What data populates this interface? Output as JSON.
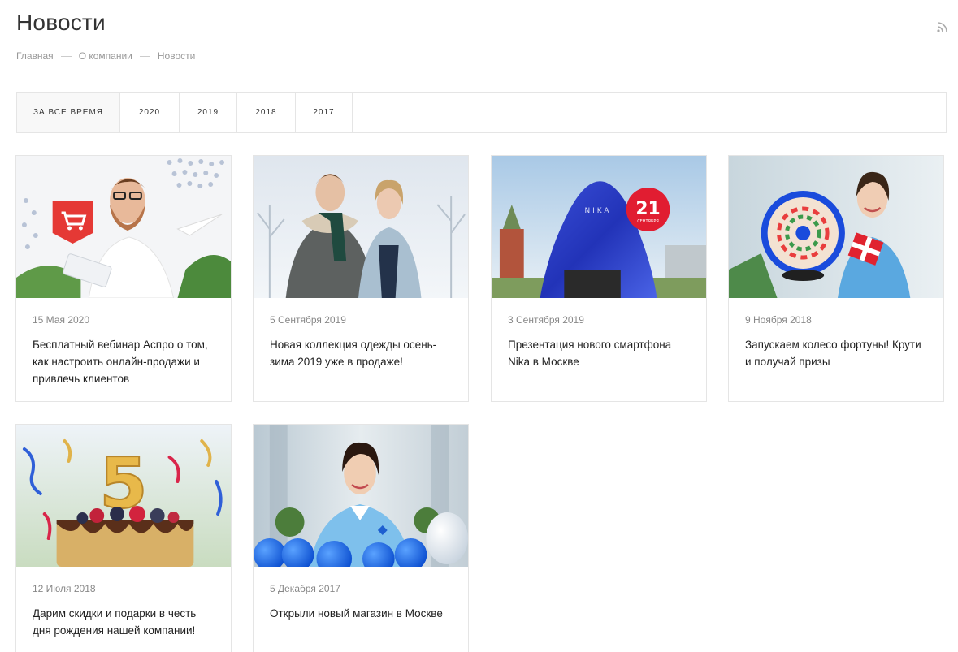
{
  "page": {
    "title": "Новости"
  },
  "breadcrumb": [
    "Главная",
    "О компании",
    "Новости"
  ],
  "filter": {
    "tabs": [
      "За все время",
      "2020",
      "2019",
      "2018",
      "2017"
    ],
    "active": 0
  },
  "news": [
    {
      "date": "15 Мая 2020",
      "title": "Бесплатный вебинар Аспро о том, как настроить онлайн-продажи и привлечь клиентов",
      "image": "man-with-tablet-and-cart-icon"
    },
    {
      "date": "5 Сентября 2019",
      "title": "Новая коллекция одежды осень-зима 2019 уже в продаже!",
      "image": "couple-in-winter-coats"
    },
    {
      "date": "3 Сентября 2019",
      "title": "Презентация нового смартфона Nika в Москве",
      "image": "covered-smartphone-kremlin",
      "image_text": {
        "brand": "NIKA",
        "day": "21",
        "month": "СЕНТЯБРЯ"
      }
    },
    {
      "date": "9 Ноября 2018",
      "title": "Запускаем колесо фортуны! Крути и получай призы",
      "image": "woman-with-fortune-wheel-and-gift"
    },
    {
      "date": "12 Июля 2018",
      "title": "Дарим скидки и подарки в честь дня рождения нашей компании!",
      "image": "birthday-cake-number-5",
      "image_text": {
        "number": "5"
      }
    },
    {
      "date": "5 Декабря 2017",
      "title": "Открыли новый магазин в Москве",
      "image": "woman-with-blue-balloons"
    }
  ]
}
